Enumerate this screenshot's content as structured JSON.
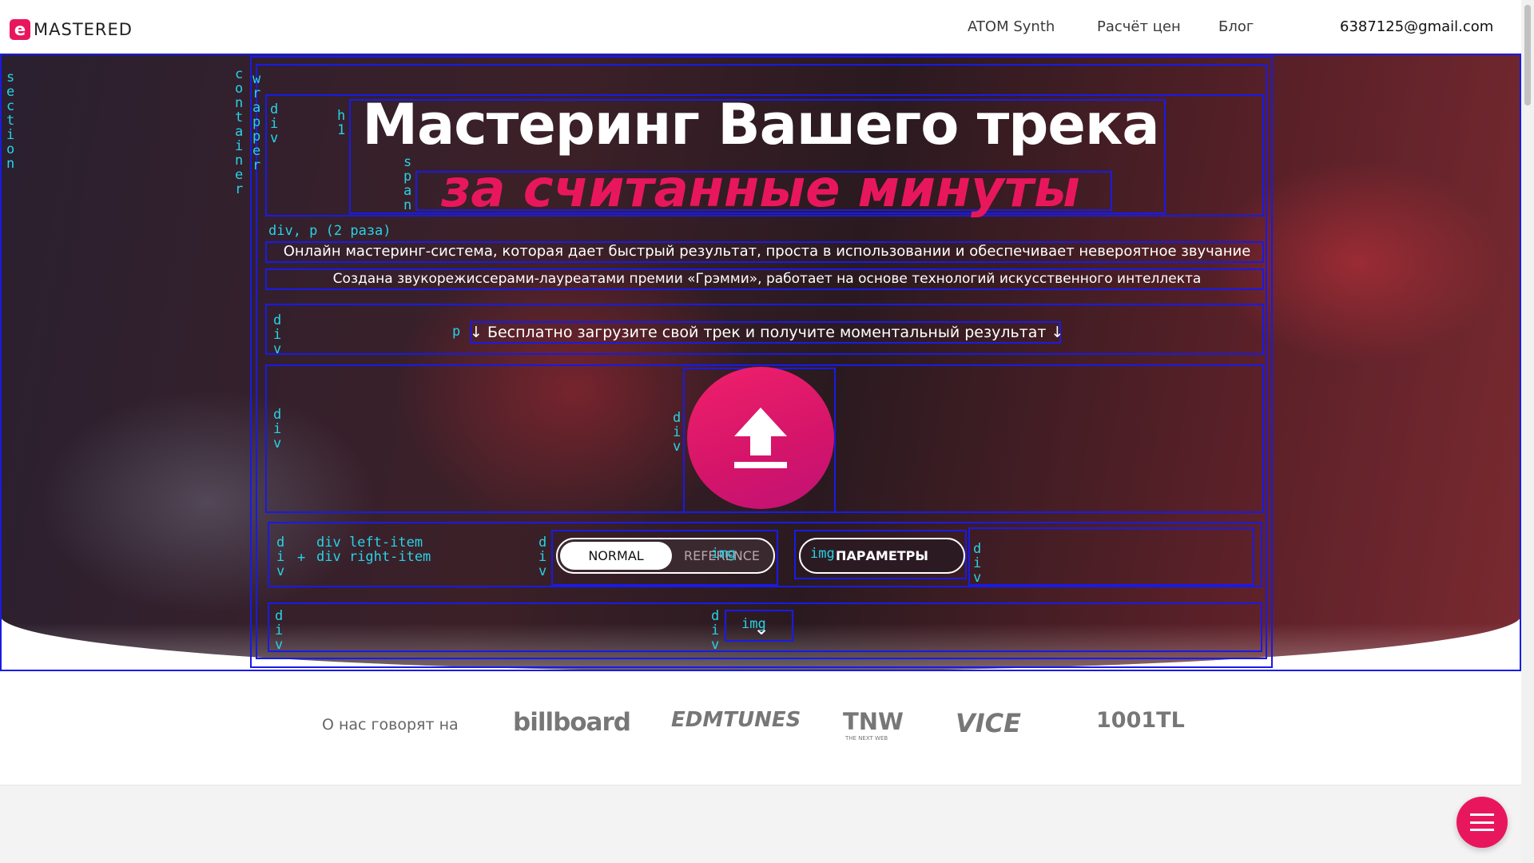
{
  "nav": {
    "logo_text": "MASTERED",
    "logo_mark": "e",
    "links": [
      "ATOM Synth",
      "Расчёт цен",
      "Блог"
    ],
    "email": "6387125@gmail.com"
  },
  "hero": {
    "title": "Мастеринг Вашего трека",
    "title_highlight": "за считанные минуты",
    "lead_1": "Онлайн мастеринг-система, которая дает быстрый результат, проста в использовании и обеспечивает невероятное звучание",
    "lead_2": "Создана звукорежиссерами-лауреатами премии «Грэмми», работает на основе технологий искусственного интеллекта",
    "cta": "↓ Бесплатно загрузите свой трек и получите моментальный результат ↓",
    "upload_icon": "upload-arrow-icon",
    "mode_toggle": {
      "normal": "NORMAL",
      "reference": "REFERENCE",
      "selected": "NORMAL"
    },
    "params_button": "ПАРАМЕТРЫ",
    "scroll_icon": "chevron-down-icon",
    "accent_color": "#e8175d"
  },
  "debug_overlay": {
    "section": "section",
    "container": "container",
    "wrapper": "wrapper",
    "div": "div",
    "h1": "h1",
    "span": "span",
    "div_p": "div, p (2 раза)",
    "p": "p",
    "img": "img",
    "left_right": "div left-item\ndiv right-item",
    "plus": "+"
  },
  "press": {
    "label": "О нас говорят на",
    "logos": [
      "billboard",
      "EDMTUNES",
      "TNW",
      "VICE",
      "1001TL"
    ],
    "tnw_caption": "THE NEXT WEB"
  },
  "chat": {
    "icon": "menu-chat-icon"
  }
}
